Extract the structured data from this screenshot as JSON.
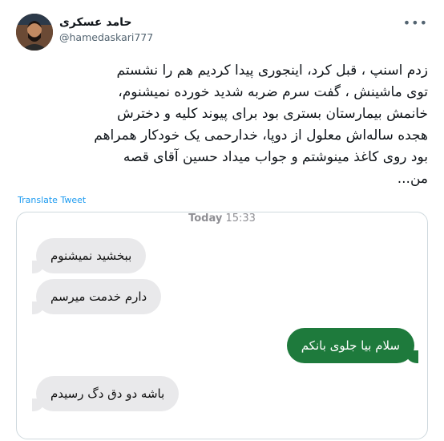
{
  "author": {
    "name": "حامد عسکری",
    "handle": "@hamedaskari777"
  },
  "more_icon": "•••",
  "tweet": {
    "text": "زدم اسنپ ، قبل کرد، اینجوری پیدا کردیم هم را نشستم\nتوی ماشینش ، گفت سرم ضربه شدید خورده نمیشنوم،\nخانمش بیمارستان بستری بود برای پیوند کلیه و دخترش\nهجده ساله‌اش معلول از دوپا، خدارحمی یک خودکار همراهم\nبود روی کاغذ مینوشتم و جواب میداد حسین آقای قصه\nمن...",
    "translate_label": "Translate Tweet"
  },
  "chat": {
    "timestamp_day": "Today",
    "timestamp_time": "15:33",
    "messages": [
      {
        "side": "in",
        "text": "ببخشید نمیشنوم"
      },
      {
        "side": "in",
        "text": "دارم خدمت میرسم"
      },
      {
        "side": "out",
        "text": "سلام بیا جلوی بانکم"
      },
      {
        "side": "in",
        "text": "باشه دو دق دگ رسیدم"
      }
    ]
  },
  "colors": {
    "link": "#1d9bf0",
    "incoming_bubble": "#e9e9eb",
    "outgoing_bubble": "#1e7a3c"
  }
}
